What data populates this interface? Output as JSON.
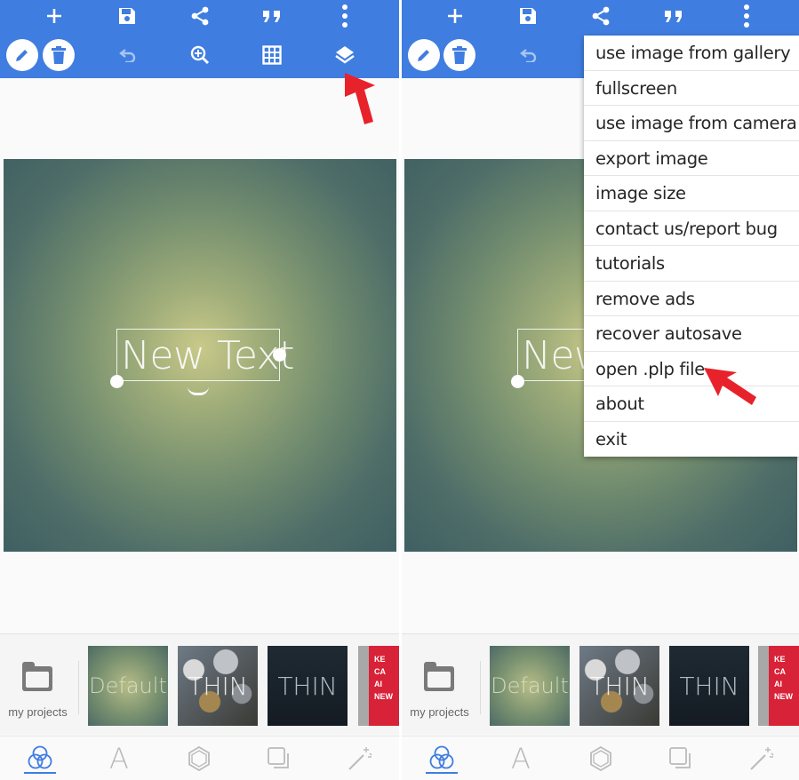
{
  "colors": {
    "accent": "#3f7de0",
    "arrow": "#e8222a",
    "menu_text": "#262626"
  },
  "toolbar": {
    "top_icons": [
      "add-icon",
      "save-icon",
      "share-icon",
      "quote-icon",
      "more-vert-icon"
    ],
    "bottom_icons": [
      "pencil-icon",
      "trash-icon",
      "undo-icon",
      "zoom-in-icon",
      "grid-icon",
      "layers-icon"
    ]
  },
  "canvas": {
    "text_layer": "New Text"
  },
  "bottom_bar": {
    "my_projects_label": "my projects",
    "templates": [
      {
        "label": "Default"
      },
      {
        "label": "THIN"
      },
      {
        "label": "THIN"
      },
      {
        "label": "KE\nCA\nAI\nNEW"
      }
    ]
  },
  "bottom_nav": {
    "items": [
      "layers-circles-icon",
      "text-icon",
      "hexagon-icon",
      "copy-squares-icon",
      "magic-wand-icon"
    ],
    "text_item_glyph": "A"
  },
  "overflow_menu": {
    "items": [
      "use image from gallery",
      "fullscreen",
      "use image from camera",
      "export image",
      "image size",
      "contact us/report bug",
      "tutorials",
      "remove ads",
      "recover autosave",
      "open .plp file",
      "about",
      "exit"
    ]
  }
}
